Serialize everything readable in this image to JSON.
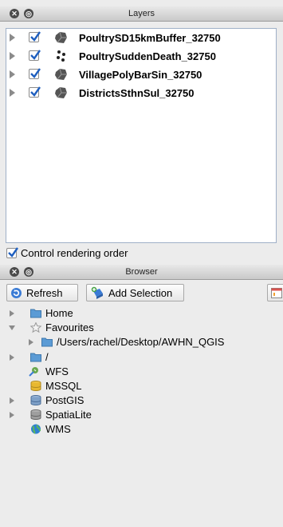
{
  "layers_panel": {
    "title": "Layers",
    "layers": [
      {
        "name": "PoultrySD15kmBuffer_32750",
        "checked": true,
        "icon": "polygon-layer-icon"
      },
      {
        "name": "PoultrySuddenDeath_32750",
        "checked": true,
        "icon": "point-layer-icon"
      },
      {
        "name": "VillagePolyBarSin_32750",
        "checked": true,
        "icon": "polygon-layer-icon"
      },
      {
        "name": "DistrictsSthnSul_32750",
        "checked": true,
        "icon": "polygon-layer-icon"
      }
    ],
    "control_rendering_order": {
      "label": "Control rendering order",
      "checked": true
    }
  },
  "browser_panel": {
    "title": "Browser",
    "refresh_label": "Refresh",
    "add_selection_label": "Add Selection",
    "tree": [
      {
        "label": "Home",
        "icon": "folder-icon",
        "expander": "collapsed",
        "indent": 0
      },
      {
        "label": "Favourites",
        "icon": "star-icon",
        "expander": "expanded",
        "indent": 0
      },
      {
        "label": "/Users/rachel/Desktop/AWHN_QGIS",
        "icon": "folder-icon",
        "expander": "collapsed",
        "indent": 1
      },
      {
        "label": "/",
        "icon": "folder-icon",
        "expander": "collapsed",
        "indent": 0
      },
      {
        "label": "WFS",
        "icon": "wfs-icon",
        "expander": "none",
        "indent": 0
      },
      {
        "label": "MSSQL",
        "icon": "database-icon",
        "expander": "none",
        "indent": 0
      },
      {
        "label": "PostGIS",
        "icon": "postgis-icon",
        "expander": "collapsed",
        "indent": 0
      },
      {
        "label": "SpatiaLite",
        "icon": "spatialite-icon",
        "expander": "collapsed",
        "indent": 0
      },
      {
        "label": "WMS",
        "icon": "globe-icon",
        "expander": "none",
        "indent": 0
      }
    ]
  },
  "colors": {
    "accent": "#3a7bd5",
    "folder": "#5b9bd5",
    "check": "#1f5fbf"
  }
}
